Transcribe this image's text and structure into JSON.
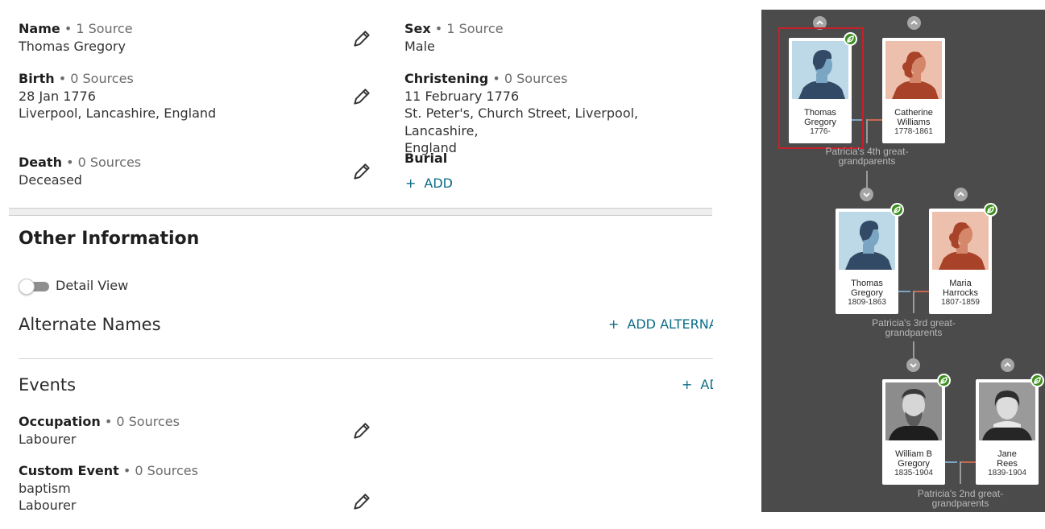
{
  "facts": {
    "name": {
      "label": "Name",
      "sources": "• 1 Source",
      "value": "Thomas Gregory"
    },
    "sex": {
      "label": "Sex",
      "sources": "• 1 Source",
      "value": "Male"
    },
    "birth": {
      "label": "Birth",
      "sources": "• 0 Sources",
      "date": "28 Jan 1776",
      "place": "Liverpool, Lancashire, England"
    },
    "christening": {
      "label": "Christening",
      "sources": "• 0 Sources",
      "date": "11 February 1776",
      "place_line1": "St. Peter's, Church Street, Liverpool, Lancashire,",
      "place_line2": "England"
    },
    "death": {
      "label": "Death",
      "sources": "• 0 Sources",
      "value": "Deceased"
    },
    "burial": {
      "label": "Burial",
      "add_label": "ADD"
    }
  },
  "other_info": {
    "title": "Other Information",
    "detail_view_label": "Detail View",
    "detail_view_on": false
  },
  "alternate_names": {
    "title": "Alternate Names",
    "add_label": "ADD ALTERNA"
  },
  "events": {
    "title": "Events",
    "add_label": "AD",
    "occupation": {
      "label": "Occupation",
      "sources": "• 0 Sources",
      "value": "Labourer"
    },
    "custom_event": {
      "label": "Custom Event",
      "sources": "• 0 Sources",
      "line1": "baptism",
      "line2": "Labourer"
    }
  },
  "tree": {
    "gen4": {
      "label_line1": "Patricia's 4th great-",
      "label_line2": "grandparents",
      "father": {
        "name1": "Thomas",
        "name2": "Gregory",
        "years": "1776-"
      },
      "mother": {
        "name1": "Catherine",
        "name2": "Williams",
        "years": "1778-1861"
      }
    },
    "gen3": {
      "label_line1": "Patricia's 3rd great-",
      "label_line2": "grandparents",
      "father": {
        "name1": "Thomas",
        "name2": "Gregory",
        "years": "1809-1863"
      },
      "mother": {
        "name1": "Maria",
        "name2": "Harrocks",
        "years": "1807-1859"
      }
    },
    "gen2": {
      "label_line1": "Patricia's 2nd great-",
      "label_line2": "grandparents",
      "father": {
        "name1": "William B",
        "name2": "Gregory",
        "years": "1835-1904"
      },
      "mother": {
        "name1": "Jane",
        "name2": "Rees",
        "years": "1839-1904"
      }
    }
  },
  "colors": {
    "link": "#0b6c87",
    "tree_bg": "#4b4b4b",
    "hint_green": "#3b8f1c",
    "focus_red": "#c8202a"
  }
}
